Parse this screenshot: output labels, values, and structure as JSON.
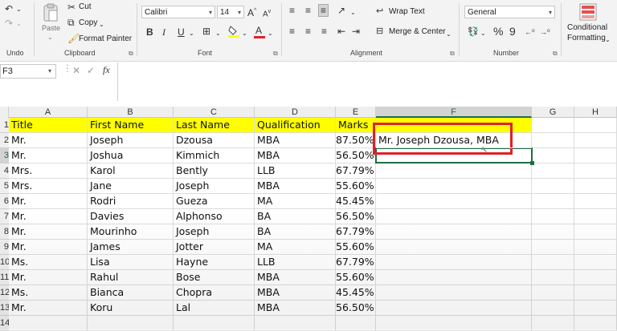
{
  "ribbon": {
    "undo": {
      "label": "Undo"
    },
    "clipboard": {
      "paste": "Paste",
      "cut": "Cut",
      "copy": "Copy",
      "format_painter": "Format Painter",
      "label": "Clipboard"
    },
    "font": {
      "name": "Calibri",
      "size": "14",
      "label": "Font",
      "bold": "B",
      "italic": "I",
      "underline": "U",
      "color_letter": "A"
    },
    "alignment": {
      "wrap_text": "Wrap Text",
      "merge_center": "Merge & Center",
      "label": "Alignment"
    },
    "number": {
      "format": "General",
      "label": "Number",
      "percent": "%",
      "comma": "9"
    },
    "styles": {
      "conditional": "Conditional",
      "formatting": "Formatting"
    }
  },
  "formula_bar": {
    "name_box": "F3",
    "fx": "fx",
    "content": ""
  },
  "columns": [
    "A",
    "B",
    "C",
    "D",
    "E",
    "F",
    "G",
    "H"
  ],
  "selected_column": "F",
  "rows": [
    {
      "n": "1",
      "title": "Title",
      "first": "First Name",
      "last": "Last Name",
      "qual": "Qualification",
      "marks": "Marks",
      "f": ""
    },
    {
      "n": "2",
      "title": "Mr.",
      "first": "Joseph",
      "last": "Dzousa",
      "qual": "MBA",
      "marks": "87.50%",
      "f": "Mr. Joseph Dzousa, MBA"
    },
    {
      "n": "3",
      "title": "Mr.",
      "first": "Joshua",
      "last": "Kimmich",
      "qual": "MBA",
      "marks": "56.50%",
      "f": ""
    },
    {
      "n": "4",
      "title": "Mrs.",
      "first": "Karol",
      "last": "Bently",
      "qual": "LLB",
      "marks": "67.79%",
      "f": ""
    },
    {
      "n": "5",
      "title": "Mrs.",
      "first": "Jane",
      "last": "Joseph",
      "qual": "MBA",
      "marks": "55.60%",
      "f": ""
    },
    {
      "n": "6",
      "title": "Mr.",
      "first": "Rodri",
      "last": "Gueza",
      "qual": "MA",
      "marks": "45.45%",
      "f": ""
    },
    {
      "n": "7",
      "title": "Mr.",
      "first": "Davies",
      "last": "Alphonso",
      "qual": "BA",
      "marks": "56.50%",
      "f": ""
    },
    {
      "n": "8",
      "title": "Mr.",
      "first": "Mourinho",
      "last": "Joseph",
      "qual": "BA",
      "marks": "67.79%",
      "f": ""
    },
    {
      "n": "9",
      "title": "Mr.",
      "first": "James",
      "last": "Jotter",
      "qual": "MA",
      "marks": "55.60%",
      "f": ""
    },
    {
      "n": "10",
      "title": "Ms.",
      "first": "Lisa",
      "last": "Hayne",
      "qual": "LLB",
      "marks": "67.79%",
      "f": ""
    },
    {
      "n": "11",
      "title": "Mr.",
      "first": "Rahul",
      "last": "Bose",
      "qual": "MBA",
      "marks": "55.60%",
      "f": ""
    },
    {
      "n": "12",
      "title": "Ms.",
      "first": "Bianca",
      "last": "Chopra",
      "qual": "MBA",
      "marks": "45.45%",
      "f": ""
    },
    {
      "n": "13",
      "title": "Mr.",
      "first": "Koru",
      "last": "Lal",
      "qual": "MBA",
      "marks": "56.50%",
      "f": ""
    },
    {
      "n": "14",
      "title": "",
      "first": "",
      "last": "",
      "qual": "",
      "marks": "",
      "f": ""
    }
  ],
  "colors": {
    "header_fill": "#ffff00",
    "selection": "#1e6e42",
    "highlight_box": "#e0202a"
  }
}
